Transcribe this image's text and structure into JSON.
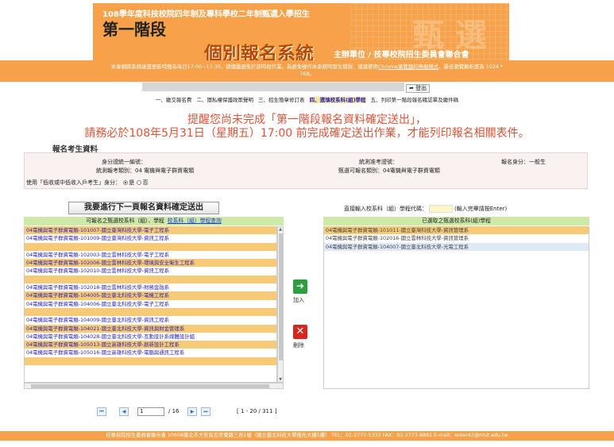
{
  "header": {
    "subtitle": "108學年度科技校院四年制及專科學校二年制甄選入學招生",
    "stage": "第一階段",
    "system": "個別報名系統",
    "host": "主辦單位 / 技專校院招生委員會聯合會",
    "watermark": "甄選"
  },
  "notice": {
    "line1_pre": "本會網路系統維護更新時間為每日17:00~17:30，請儘量避免於該時段作業。為避免操作本系統時發生錯誤，建議使用",
    "line1_link1": "Chrome瀏覽器的無痕模式",
    "line1_mid": "，最佳瀏覽解析度為 1024 *",
    "line2": "768。"
  },
  "logout_label": "登出",
  "steps": [
    {
      "label": "一、繳交報名費",
      "active": false
    },
    {
      "label": "二、隱私權保護政策聲明",
      "active": false
    },
    {
      "label": "三、招生簡章修訂表",
      "active": false
    },
    {
      "label": "四、選填校系科(組)學程",
      "active": true
    },
    {
      "label": "五、列印第一階段報名確認單及繳件碼",
      "active": false
    }
  ],
  "warning": {
    "line1": "提醒您尚未完成「第一階段報名資料確定送出」，",
    "line2": "請務必於108年5月31日（星期五）17:00 前完成確定送出作業，才能列印報名相關表件。"
  },
  "applicant": {
    "section_title": "報名考生資料",
    "id_label": "身分證統一編號：",
    "exam_no_label": "統測准考證號：",
    "status_label": "報名身分：",
    "status_value": "一般生",
    "category_label": "統測報考類別：",
    "category_value": "04 電機與電子群資電類",
    "apply_category_label": "甄選可報名類別：",
    "apply_category_value": "04電機與電子群資電類",
    "low_income_label": "使用「低收或中低收入戶考生」身分：",
    "yes": "是",
    "no": "否"
  },
  "next_button": "我要進行下一頁報名資料確定送出",
  "left": {
    "header": "可報名之甄選校系科（組）、學程",
    "header_link": "校系科（組）學程查詢",
    "items": [
      {
        "text": "04電機與電子群資電類-101007-國立臺灣科技大學-電子工程系",
        "style": "o"
      },
      {
        "text": "04電機與電子群資電類-101009-國立臺灣科技大學-資訊工程系",
        "style": "w"
      },
      {
        "text": "",
        "style": "o"
      },
      {
        "text": "04電機與電子群資電類-102003-國立雲林科技大學-電子工程系",
        "style": "w"
      },
      {
        "text": "04電機與電子群資電類-102006-國立雲林科技大學-環境與安全衛生工程系",
        "style": "o"
      },
      {
        "text": "04電機與電子群資電類-102010-國立雲林科技大學-資訊工程系",
        "style": "w"
      },
      {
        "text": "",
        "style": "o"
      },
      {
        "text": "04電機與電子群資電類-102018-國立雲林科技大學-財務金融系",
        "style": "w"
      },
      {
        "text": "04電機與電子群資電類-104005-國立臺北科技大學-電機工程系",
        "style": "o"
      },
      {
        "text": "04電機與電子群資電類-104006-國立臺北科技大學-電子工程系",
        "style": "w"
      },
      {
        "text": "",
        "style": "o"
      },
      {
        "text": "04電機與電子群資電類-104009-國立臺北科技大學-資訊工程系",
        "style": "w"
      },
      {
        "text": "04電機與電子群資電類-104021-國立臺北科技大學-資訊與財金管理系",
        "style": "o"
      },
      {
        "text": "04電機與電子群資電類-104028-國立臺北科技大學-互動設計系媒體設計組",
        "style": "w"
      },
      {
        "text": "04電機與電子群資電類-105013-國立高雄科技大學-創新設計工程系",
        "style": "o"
      },
      {
        "text": "04電機與電子群資電類-105016-國立高雄科技大學-電腦與通訊工程系",
        "style": "w"
      },
      {
        "text": "",
        "style": "o"
      }
    ]
  },
  "pager": {
    "page": "1",
    "total": "/ 16",
    "range": "[ 1 - 20 / 311 ]"
  },
  "add_label": "加入",
  "delete_label": "刪除",
  "right": {
    "code_label": "直接輸入校系科（組）學程代碼：",
    "code_hint": "(輸入完畢請按Enter)",
    "header": "已選取之甄選校系科(組)學程",
    "items": [
      {
        "text": "04電機與電子群資電類-101011-國立臺灣科技大學-資訊管理系",
        "style": "o"
      },
      {
        "text": "04電機與電子群資電類-102016-國立雲林科技大學-資訊管理系",
        "style": "w"
      },
      {
        "text": "04電機與電子群資電類-104007-國立臺北科技大學-光電工程系",
        "style": "b"
      }
    ]
  },
  "footer": "技專校院招生委員會聯合會 10608臺北市大安區忠孝東路三段1號（國立臺北科技大學億光大樓5樓） TEL：02-2772-5333 FAX：02-2773-8881 E-mail：enter42@ntut.edu.tw",
  "colors": {
    "accent": "#f7a24a",
    "row_highlight": "#f6ca76",
    "list_header": "#cfe9a9",
    "add": "#2e9f3e",
    "delete": "#d7261e"
  }
}
